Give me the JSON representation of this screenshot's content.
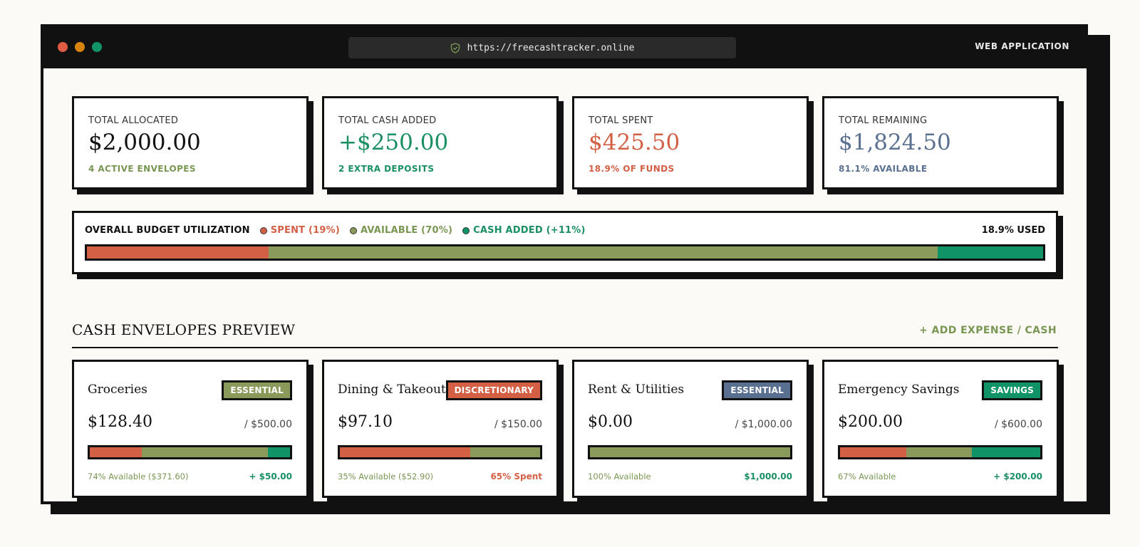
{
  "colors": {
    "red": "#d35f45",
    "olive": "#8a9a5b",
    "green": "#0f9367",
    "slate": "#5a7090",
    "dark": "#111111"
  },
  "browser": {
    "url": "https://freecashtracker.online",
    "app_tag": "WEB APPLICATION",
    "dots": [
      "#e05d44",
      "#d8830c",
      "#0f9367"
    ]
  },
  "stats": [
    {
      "label": "TOTAL ALLOCATED",
      "value": "$2,000.00",
      "sub": "4 ACTIVE ENVELOPES",
      "value_color": "#111111",
      "sub_color": "#7a9653"
    },
    {
      "label": "TOTAL CASH ADDED",
      "value": "+$250.00",
      "sub": "2 EXTRA DEPOSITS",
      "value_color": "#1a8f62",
      "sub_color": "#1a8f62"
    },
    {
      "label": "TOTAL SPENT",
      "value": "$425.50",
      "sub": "18.9% OF FUNDS",
      "value_color": "#d35f45",
      "sub_color": "#d35f45"
    },
    {
      "label": "TOTAL REMAINING",
      "value": "$1,824.50",
      "sub": "81.1% AVAILABLE",
      "value_color": "#5a7090",
      "sub_color": "#5a7090"
    }
  ],
  "utilization": {
    "title": "OVERALL BUDGET UTILIZATION",
    "legend": [
      {
        "label": "SPENT (19%)",
        "color": "#d35f45"
      },
      {
        "label": "AVAILABLE (70%)",
        "color": "#8a9a5b"
      },
      {
        "label": "CASH ADDED (+11%)",
        "color": "#0f9367"
      }
    ],
    "used_label": "18.9% USED",
    "segments": [
      {
        "name": "spent",
        "percent": 19,
        "color": "#d35f45"
      },
      {
        "name": "available",
        "percent": 70,
        "color": "#8a9a5b"
      },
      {
        "name": "cash-added",
        "percent": 11,
        "color": "#0f9367"
      }
    ]
  },
  "section": {
    "title": "CASH ENVELOPES PREVIEW",
    "add_label": "+ ADD EXPENSE / CASH"
  },
  "envelopes": [
    {
      "name": "Groceries",
      "tag": "ESSENTIAL",
      "tag_color": "#8a9a5b",
      "amount": "$128.40",
      "total": "/ $500.00",
      "foot_left": "74% Available ($371.60)",
      "foot_right": "+ $50.00",
      "foot_right_color": "#1a8f62",
      "segments": [
        {
          "percent": 26,
          "color": "#d35f45"
        },
        {
          "percent": 63,
          "color": "#8a9a5b"
        },
        {
          "percent": 11,
          "color": "#0f9367"
        }
      ]
    },
    {
      "name": "Dining & Takeout",
      "tag": "DISCRETIONARY",
      "tag_color": "#d35f45",
      "amount": "$97.10",
      "total": "/ $150.00",
      "foot_left": "35% Available ($52.90)",
      "foot_right": "65% Spent",
      "foot_right_color": "#d35f45",
      "segments": [
        {
          "percent": 65,
          "color": "#d35f45"
        },
        {
          "percent": 35,
          "color": "#8a9a5b"
        }
      ]
    },
    {
      "name": "Rent & Utilities",
      "tag": "ESSENTIAL",
      "tag_color": "#5a7090",
      "amount": "$0.00",
      "total": "/ $1,000.00",
      "foot_left": "100% Available",
      "foot_right": "$1,000.00",
      "foot_right_color": "#1a8f62",
      "segments": [
        {
          "percent": 100,
          "color": "#8a9a5b"
        }
      ]
    },
    {
      "name": "Emergency Savings",
      "tag": "SAVINGS",
      "tag_color": "#0f9367",
      "amount": "$200.00",
      "total": "/ $600.00",
      "foot_left": "67% Available",
      "foot_right": "+ $200.00",
      "foot_right_color": "#1a8f62",
      "segments": [
        {
          "percent": 33,
          "color": "#d35f45"
        },
        {
          "percent": 33,
          "color": "#8a9a5b"
        },
        {
          "percent": 34,
          "color": "#0f9367"
        }
      ]
    }
  ]
}
